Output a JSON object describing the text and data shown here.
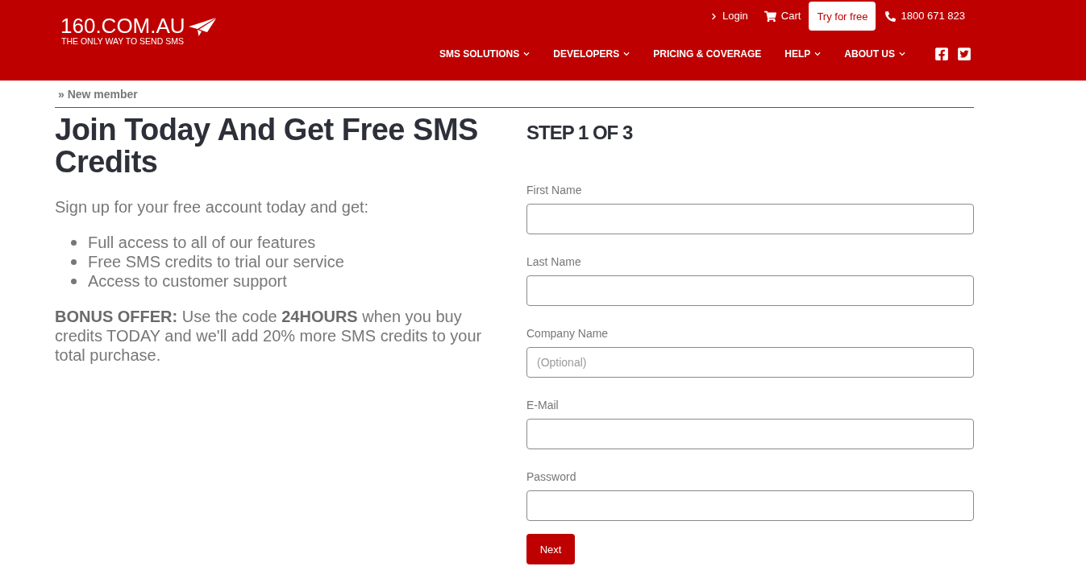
{
  "header": {
    "logo": {
      "title": "160.COM.AU",
      "tagline": "THE ONLY WAY TO SEND SMS"
    },
    "top_links": [
      {
        "kind": "login",
        "label": "Login"
      },
      {
        "kind": "cart",
        "label": "Cart"
      },
      {
        "kind": "signup",
        "label": "Try for free"
      },
      {
        "kind": "phone",
        "label": "1800 671 823"
      }
    ],
    "nav": [
      {
        "label": "SMS SOLUTIONS",
        "has_menu": true
      },
      {
        "label": "DEVELOPERS",
        "has_menu": true
      },
      {
        "label": "PRICING & COVERAGE",
        "has_menu": false
      },
      {
        "label": "HELP",
        "has_menu": true
      },
      {
        "label": "ABOUT US",
        "has_menu": true
      }
    ]
  },
  "breadcrumb": "» New member",
  "intro": {
    "title": "Join Today And Get Free SMS Credits",
    "lead": "Sign up for your free account today and get:",
    "features": [
      "Full access to all of our features",
      "Free SMS credits to trial our service",
      "Access to customer support"
    ],
    "bonus": "**BONUS OFFER:** Use the code **24HOURS** when you buy credits TODAY and we'll add 20% more SMS credits to your total purchase."
  },
  "form": {
    "step": "STEP 1 OF 3",
    "fields": [
      {
        "label": "First Name"
      },
      {
        "label": "Last Name"
      },
      {
        "label": "Company Name",
        "placeholder": "(Optional)"
      },
      {
        "label": "E-Mail"
      },
      {
        "label": "Password"
      }
    ],
    "submit": "Next"
  }
}
